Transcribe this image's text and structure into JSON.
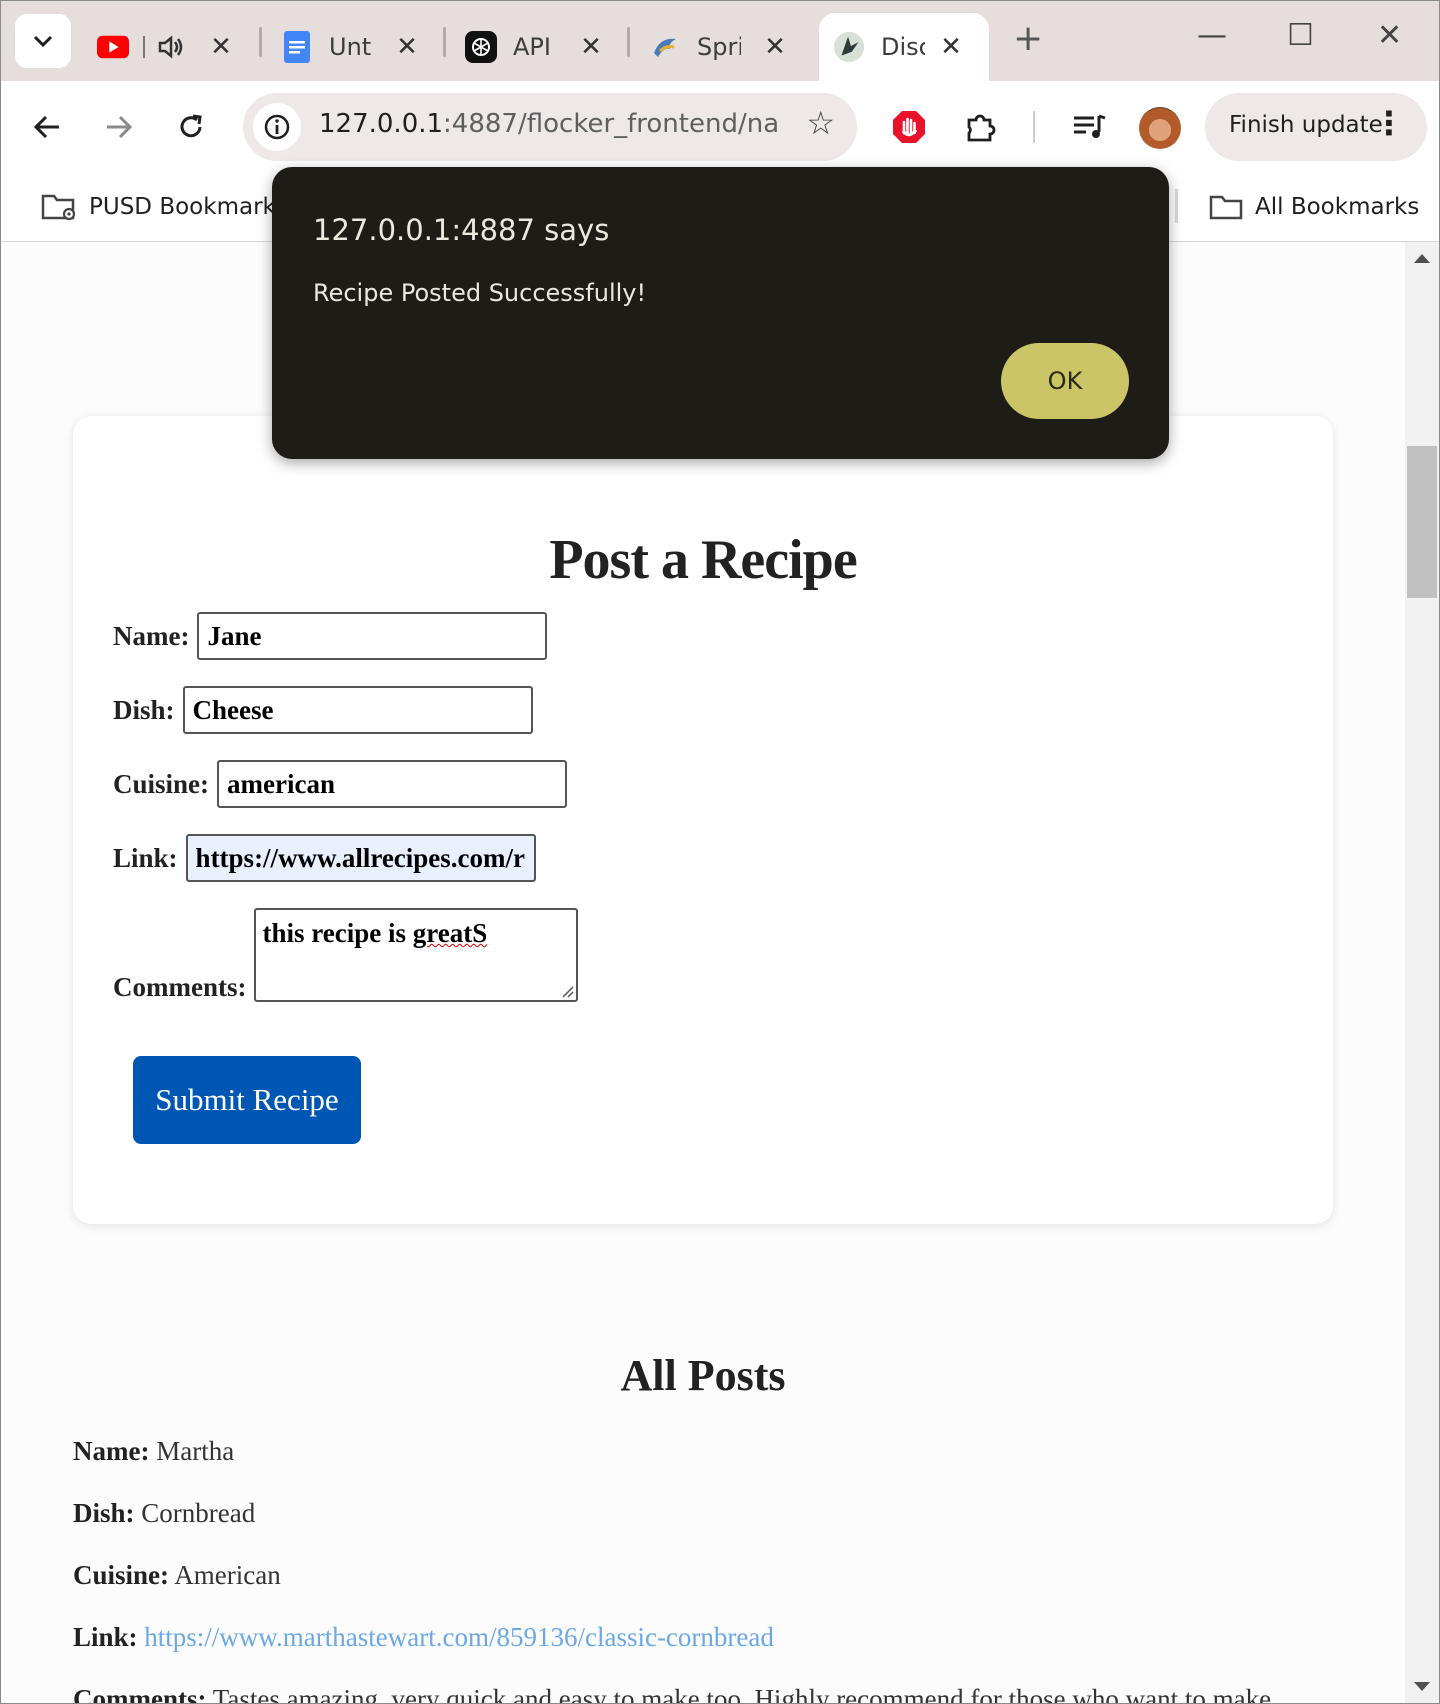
{
  "tabs": [
    {
      "title": "",
      "favicon": "youtube-icon",
      "audio": true
    },
    {
      "title": "Unti",
      "favicon": "google-docs-icon"
    },
    {
      "title": "API",
      "favicon": "openai-icon"
    },
    {
      "title": "Spri",
      "favicon": "bird-icon"
    },
    {
      "title": "Disc",
      "favicon": "fox-logo-icon",
      "active": true
    }
  ],
  "toolbar": {
    "url_host": "127.0.0.1",
    "url_rest": ":4887/flocker_frontend/na...",
    "update_label": "Finish update"
  },
  "bookmarks": {
    "folder": "PUSD Bookmarks",
    "all": "All Bookmarks"
  },
  "dialog": {
    "title": "127.0.0.1:4887 says",
    "message": "Recipe Posted Successfully!",
    "ok_label": "OK"
  },
  "form": {
    "heading": "Post a Recipe",
    "name_label": "Name:",
    "name_value": "Jane",
    "dish_label": "Dish:",
    "dish_value": "Cheese",
    "cuisine_label": "Cuisine:",
    "cuisine_value": "american",
    "link_label": "Link:",
    "link_value": "https://www.allrecipes.com/r",
    "comments_label": "Comments:",
    "comments_prefix": "this recipe is ",
    "comments_misspelled": "greatS",
    "submit_label": "Submit Recipe"
  },
  "posts": {
    "heading": "All Posts",
    "items": [
      {
        "name_label": "Name:",
        "name": "Martha",
        "dish_label": "Dish:",
        "dish": "Cornbread",
        "cuisine_label": "Cuisine:",
        "cuisine": "American",
        "link_label": "Link:",
        "link": "https://www.marthastewart.com/859136/classic-cornbread",
        "comments_label": "Comments:",
        "comments": "Tastes amazing, very quick and easy to make too. Highly recommend for those who want to make"
      }
    ]
  },
  "colors": {
    "submit_button": "#0056b3",
    "dialog_bg": "#1d1c17",
    "ok_button": "#cbc567",
    "link": "#6aa8e6"
  }
}
